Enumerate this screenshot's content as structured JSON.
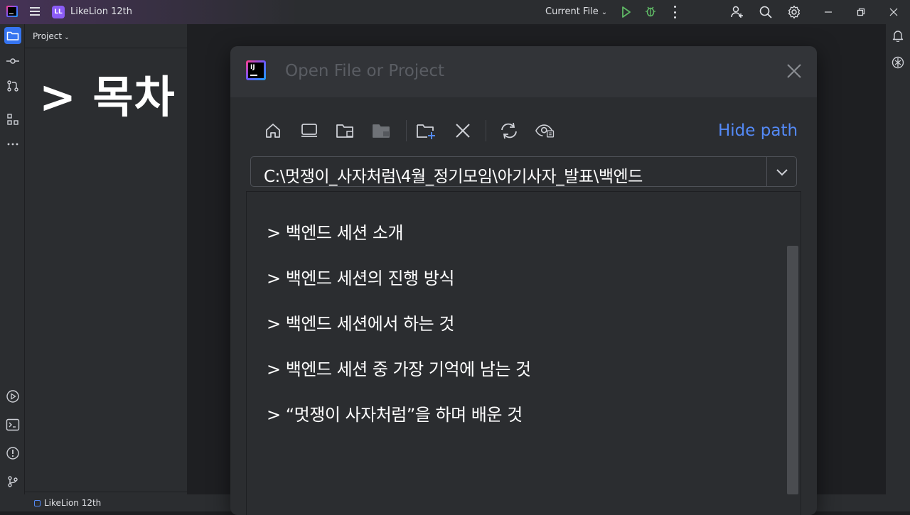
{
  "titlebar": {
    "app_badge": "LL",
    "project_name": "LikeLion 12th",
    "run_config": "Current File"
  },
  "project_panel": {
    "header": "Project",
    "slide_title": "> 목차"
  },
  "statusbar": {
    "project": "LikeLion 12th"
  },
  "dialog": {
    "title": "Open File or Project",
    "hide_path_label": "Hide path",
    "path_value": "C:\\멋쟁이_사자처럼\\4월_정기모임\\아기사자_발표\\백엔드",
    "items": [
      "> 백엔드 세션 소개",
      "> 백엔드 세션의 진행 방식",
      "> 백엔드 세션에서 하는 것",
      "> 백엔드 세션 중 가장 기억에 남는 것",
      "> “멋쟁이 사자처럼”을 하며 배운 것"
    ]
  },
  "colors": {
    "accent": "#3574f0",
    "link": "#548af7",
    "run": "#5fb865",
    "badge": "#8b5cf6"
  }
}
